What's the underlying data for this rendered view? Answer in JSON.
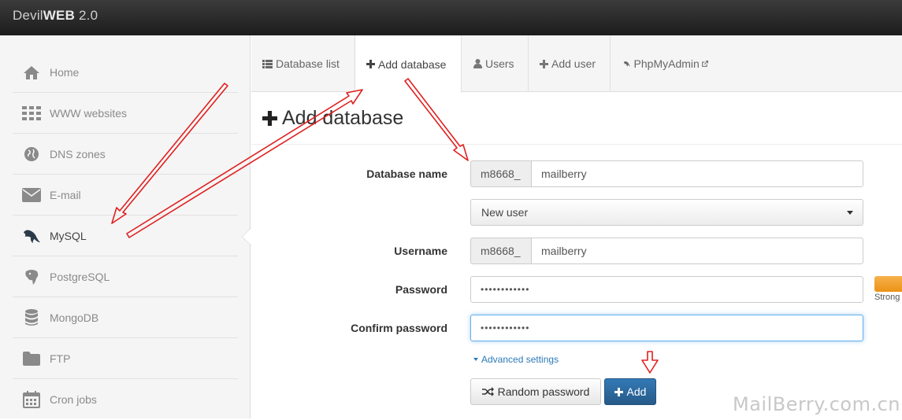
{
  "brand": {
    "prefix": "Devil",
    "bold": "WEB",
    "suffix": " 2.0"
  },
  "sidebar": {
    "items": [
      {
        "label": "Home",
        "icon": "home-icon"
      },
      {
        "label": "WWW websites",
        "icon": "grid-icon"
      },
      {
        "label": "DNS zones",
        "icon": "globe-icon"
      },
      {
        "label": "E-mail",
        "icon": "envelope-icon"
      },
      {
        "label": "MySQL",
        "icon": "dolphin-icon",
        "active": true
      },
      {
        "label": "PostgreSQL",
        "icon": "elephant-icon"
      },
      {
        "label": "MongoDB",
        "icon": "database-icon"
      },
      {
        "label": "FTP",
        "icon": "folder-icon"
      },
      {
        "label": "Cron jobs",
        "icon": "calendar-icon"
      }
    ]
  },
  "tabs": [
    {
      "label": "Database list",
      "icon": "list-icon"
    },
    {
      "label": "Add database",
      "icon": "plus-icon",
      "active": true
    },
    {
      "label": "Users",
      "icon": "user-icon"
    },
    {
      "label": "Add user",
      "icon": "plus-icon"
    },
    {
      "label": "PhpMyAdmin",
      "icon": "dolphin-icon"
    }
  ],
  "page_title": "Add database",
  "form": {
    "db_name_label": "Database name",
    "db_prefix": "m8668_",
    "db_name_value": "mailberry",
    "user_select_value": "New user",
    "username_label": "Username",
    "user_prefix": "m8668_",
    "username_value": "mailberry",
    "password_label": "Password",
    "password_value": "••••••••••••",
    "confirm_label": "Confirm password",
    "confirm_value": "••••••••••••",
    "strength_label": "Strong",
    "advanced_link": "Advanced settings",
    "random_button": "Random password",
    "add_button": "Add"
  },
  "colors": {
    "primary": "#286090",
    "link": "#2a7ab8",
    "strength": "#f0a030",
    "annotation": "#e02020"
  },
  "watermark": "MailBerry.com.cn"
}
